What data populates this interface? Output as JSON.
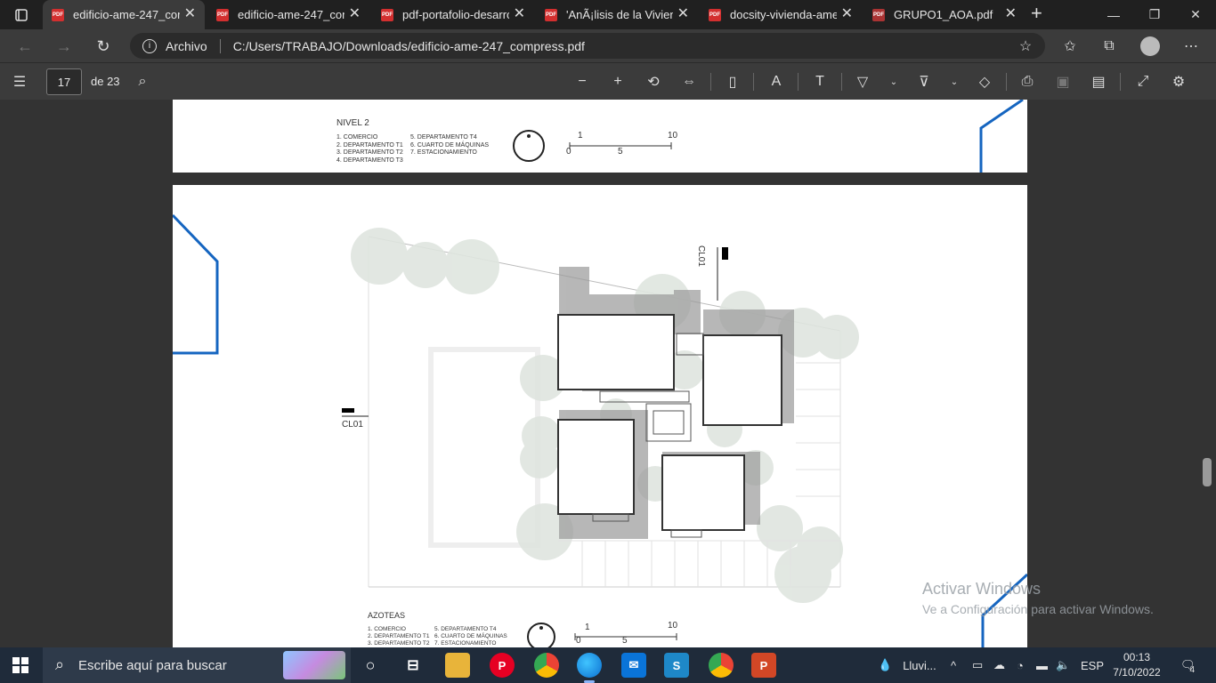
{
  "browser": {
    "tabs": [
      {
        "label": "edificio-ame-247_com",
        "active": true
      },
      {
        "label": "edificio-ame-247_com",
        "active": false
      },
      {
        "label": "pdf-portafolio-desarro",
        "active": false
      },
      {
        "label": "'AnÃ¡lisis de la Viviend",
        "active": false
      },
      {
        "label": "docsity-vivienda-ame",
        "active": false
      },
      {
        "label": "GRUPO1_AOA.pdf",
        "active": false
      }
    ],
    "address": {
      "security_label": "Archivo",
      "url": "C:/Users/TRABAJO/Downloads/edificio-ame-247_compress.pdf"
    }
  },
  "pdf_toolbar": {
    "page_current": "17",
    "page_total": "de 23"
  },
  "document": {
    "top_page": {
      "level_title": "NIVEL 2",
      "legend_col1": [
        "1. COMERCIO",
        "2. DEPARTAMENTO T1",
        "3. DEPARTAMENTO T2",
        "4. DEPARTAMENTO T3"
      ],
      "legend_col2": [
        "5. DEPARTAMENTO T4",
        "6. CUARTO DE MÁQUINAS",
        "7. ESTACIONAMIENTO"
      ],
      "scale": {
        "a": "1",
        "b": "10",
        "c": "0",
        "d": "5"
      }
    },
    "main_page": {
      "cut_label_vertical": "CL01",
      "cut_label_horizontal": "CL01",
      "level_title": "AZOTEAS",
      "legend_col1": [
        "1. COMERCIO",
        "2. DEPARTAMENTO T1",
        "3. DEPARTAMENTO T2"
      ],
      "legend_col2": [
        "5. DEPARTAMENTO T4",
        "6. CUARTO DE MÁQUINAS",
        "7. ESTACIONAMIENTO"
      ],
      "scale": {
        "a": "1",
        "b": "10",
        "c": "0",
        "d": "5"
      }
    },
    "watermark": {
      "line1": "Activar Windows",
      "line2": "Ve a Configuración para activar Windows."
    }
  },
  "taskbar": {
    "search_placeholder": "Escribe aquí para buscar",
    "weather": "Lluvi...",
    "language": "ESP",
    "time": "00:13",
    "date": "7/10/2022",
    "notifications": "4"
  }
}
